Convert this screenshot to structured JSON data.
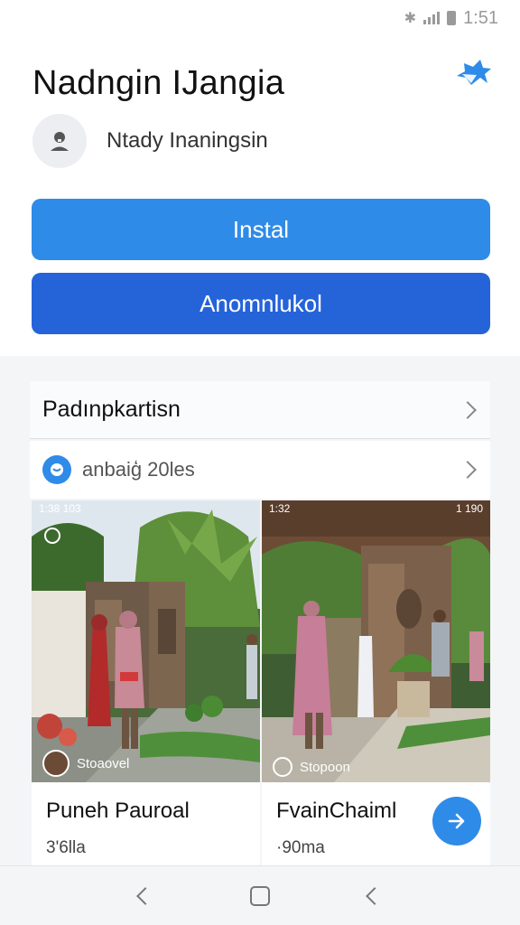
{
  "status_bar": {
    "time": "1:51",
    "icons": [
      "bluetooth-icon",
      "signal-icon",
      "battery-icon"
    ]
  },
  "header": {
    "title": "Nadngin IJangia",
    "icon": "star-icon"
  },
  "developer": {
    "name": "Ntady Inaningsin",
    "icon": "person-icon"
  },
  "buttons": {
    "install_label": "Instal",
    "secondary_label": "Anomnlukol"
  },
  "section": {
    "title": "Padınpkartisn"
  },
  "subsection": {
    "label": "anbaiģ 20les"
  },
  "cards": [
    {
      "image_status_time": "1:38 103",
      "caption": "Stoaovel",
      "title": "Puneh Pauroal",
      "subtitle": "3'6lla"
    },
    {
      "image_status_time": "1:32",
      "image_status_right": "1 190",
      "caption": "Stopoon",
      "title": "FvainChaiml",
      "subtitle": "·90ma"
    }
  ],
  "colors": {
    "primary": "#2f8be8",
    "primary_dark": "#2563d8",
    "background": "#f4f5f7"
  },
  "nav": {
    "icons": [
      "back-icon",
      "home-icon",
      "back-icon"
    ]
  }
}
